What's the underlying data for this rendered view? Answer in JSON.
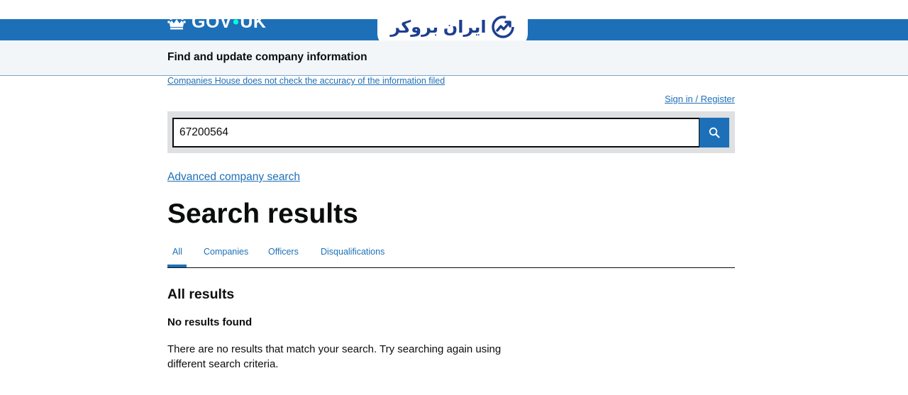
{
  "header": {
    "brand": "GOV",
    "brand_suffix": "UK",
    "crown_icon": "crown-icon",
    "color": "#1d70b8"
  },
  "watermark": {
    "text": "ایران بروکر",
    "icon": "growth-chart-logo-icon"
  },
  "service": {
    "name": "Find and update company information"
  },
  "notice": {
    "disclaimer": "Companies House does not check the accuracy of the information filed"
  },
  "account": {
    "signin_label": "Sign in / Register"
  },
  "search": {
    "value": "67200564",
    "button_icon": "search-icon"
  },
  "links": {
    "advanced": "Advanced company search"
  },
  "page": {
    "title": "Search results"
  },
  "tabs": [
    {
      "label": "All",
      "selected": true
    },
    {
      "label": "Companies",
      "selected": false
    },
    {
      "label": "Officers",
      "selected": false
    },
    {
      "label": "Disqualifications",
      "selected": false
    }
  ],
  "results": {
    "section_title": "All results",
    "heading": "No results found",
    "message": "There are no results that match your search. Try searching again using different search criteria."
  }
}
